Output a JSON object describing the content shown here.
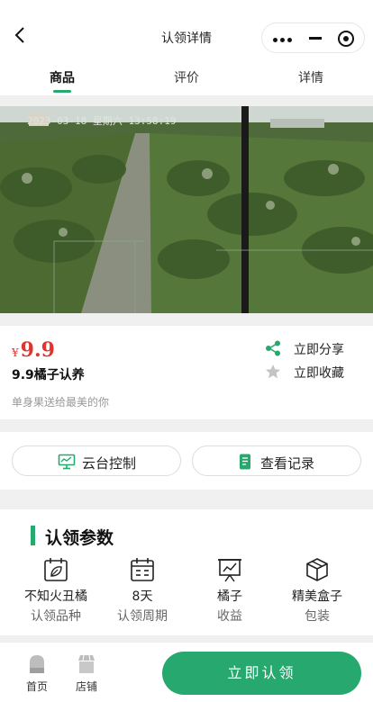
{
  "header": {
    "title": "认领详情"
  },
  "tabs": [
    {
      "label": "商品",
      "active": true
    },
    {
      "label": "评价",
      "active": false
    },
    {
      "label": "详情",
      "active": false
    }
  ],
  "camera": {
    "overlay_text": "2023-03-18 星期六 13:58:19"
  },
  "product": {
    "currency": "¥",
    "price": "9.9",
    "name": "9.9橘子认养",
    "description": "单身果送给最美的你",
    "actions": {
      "share": "立即分享",
      "favorite": "立即收藏"
    }
  },
  "buttons": {
    "ptz": "云台控制",
    "records": "查看记录"
  },
  "params": {
    "title": "认领参数",
    "items": [
      {
        "value": "不知火丑橘",
        "label": "认领品种",
        "icon": "leaf-calendar-icon"
      },
      {
        "value": "8天",
        "label": "认领周期",
        "icon": "calendar-icon"
      },
      {
        "value": "橘子",
        "label": "收益",
        "icon": "chart-board-icon"
      },
      {
        "value": "精美盒子",
        "label": "包装",
        "icon": "box-icon"
      }
    ]
  },
  "bottom_nav": {
    "home": "首页",
    "shop": "店铺",
    "cta": "立即认领"
  },
  "colors": {
    "accent": "#27a86e",
    "price": "#e0342f"
  }
}
